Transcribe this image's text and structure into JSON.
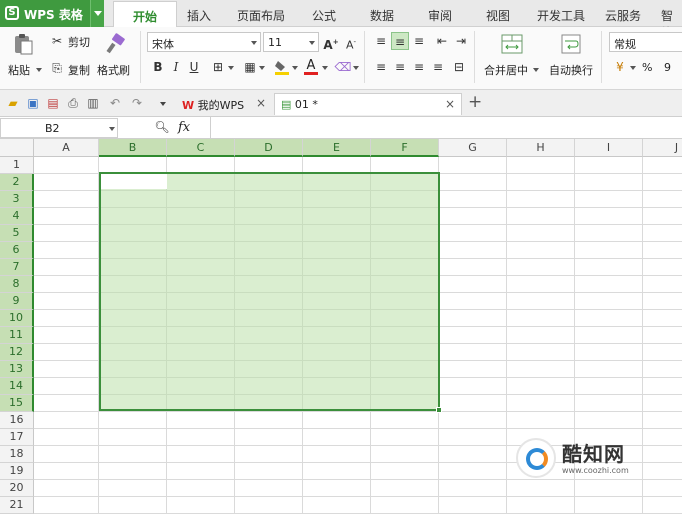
{
  "app": {
    "name": "WPS 表格",
    "logo": "S"
  },
  "menu": [
    "开始",
    "插入",
    "页面布局",
    "公式",
    "数据",
    "审阅",
    "视图",
    "开发工具",
    "云服务",
    "智能"
  ],
  "ribbon": {
    "paste": "粘贴",
    "cut": "剪切",
    "copy": "复制",
    "format_painter": "格式刷",
    "font_name": "宋体",
    "font_size": "11",
    "merge_center": "合并居中",
    "wrap_text": "自动换行",
    "number_format": "常规",
    "percent": "%",
    "comma": "9"
  },
  "doc_tabs": [
    {
      "label": "我的WPS",
      "close": "×"
    },
    {
      "label": "01 *",
      "close": "×"
    }
  ],
  "new_tab": "+",
  "formula_bar": {
    "name_box": "B2",
    "fx": "fx"
  },
  "columns": [
    "A",
    "B",
    "C",
    "D",
    "E",
    "F",
    "G",
    "H",
    "I",
    "J"
  ],
  "rows": [
    "1",
    "2",
    "3",
    "4",
    "5",
    "6",
    "7",
    "8",
    "9",
    "10",
    "11",
    "12",
    "13",
    "14",
    "15",
    "16",
    "17",
    "18",
    "19",
    "20",
    "21"
  ],
  "selection": {
    "range": "B2:F15"
  },
  "watermark": {
    "title": "酷知网",
    "url": "www.coozhi.com"
  },
  "colors": {
    "accent": "#3f9a3f",
    "selection_fill": "#d9eecb",
    "selection_border": "#3b8f3b"
  }
}
